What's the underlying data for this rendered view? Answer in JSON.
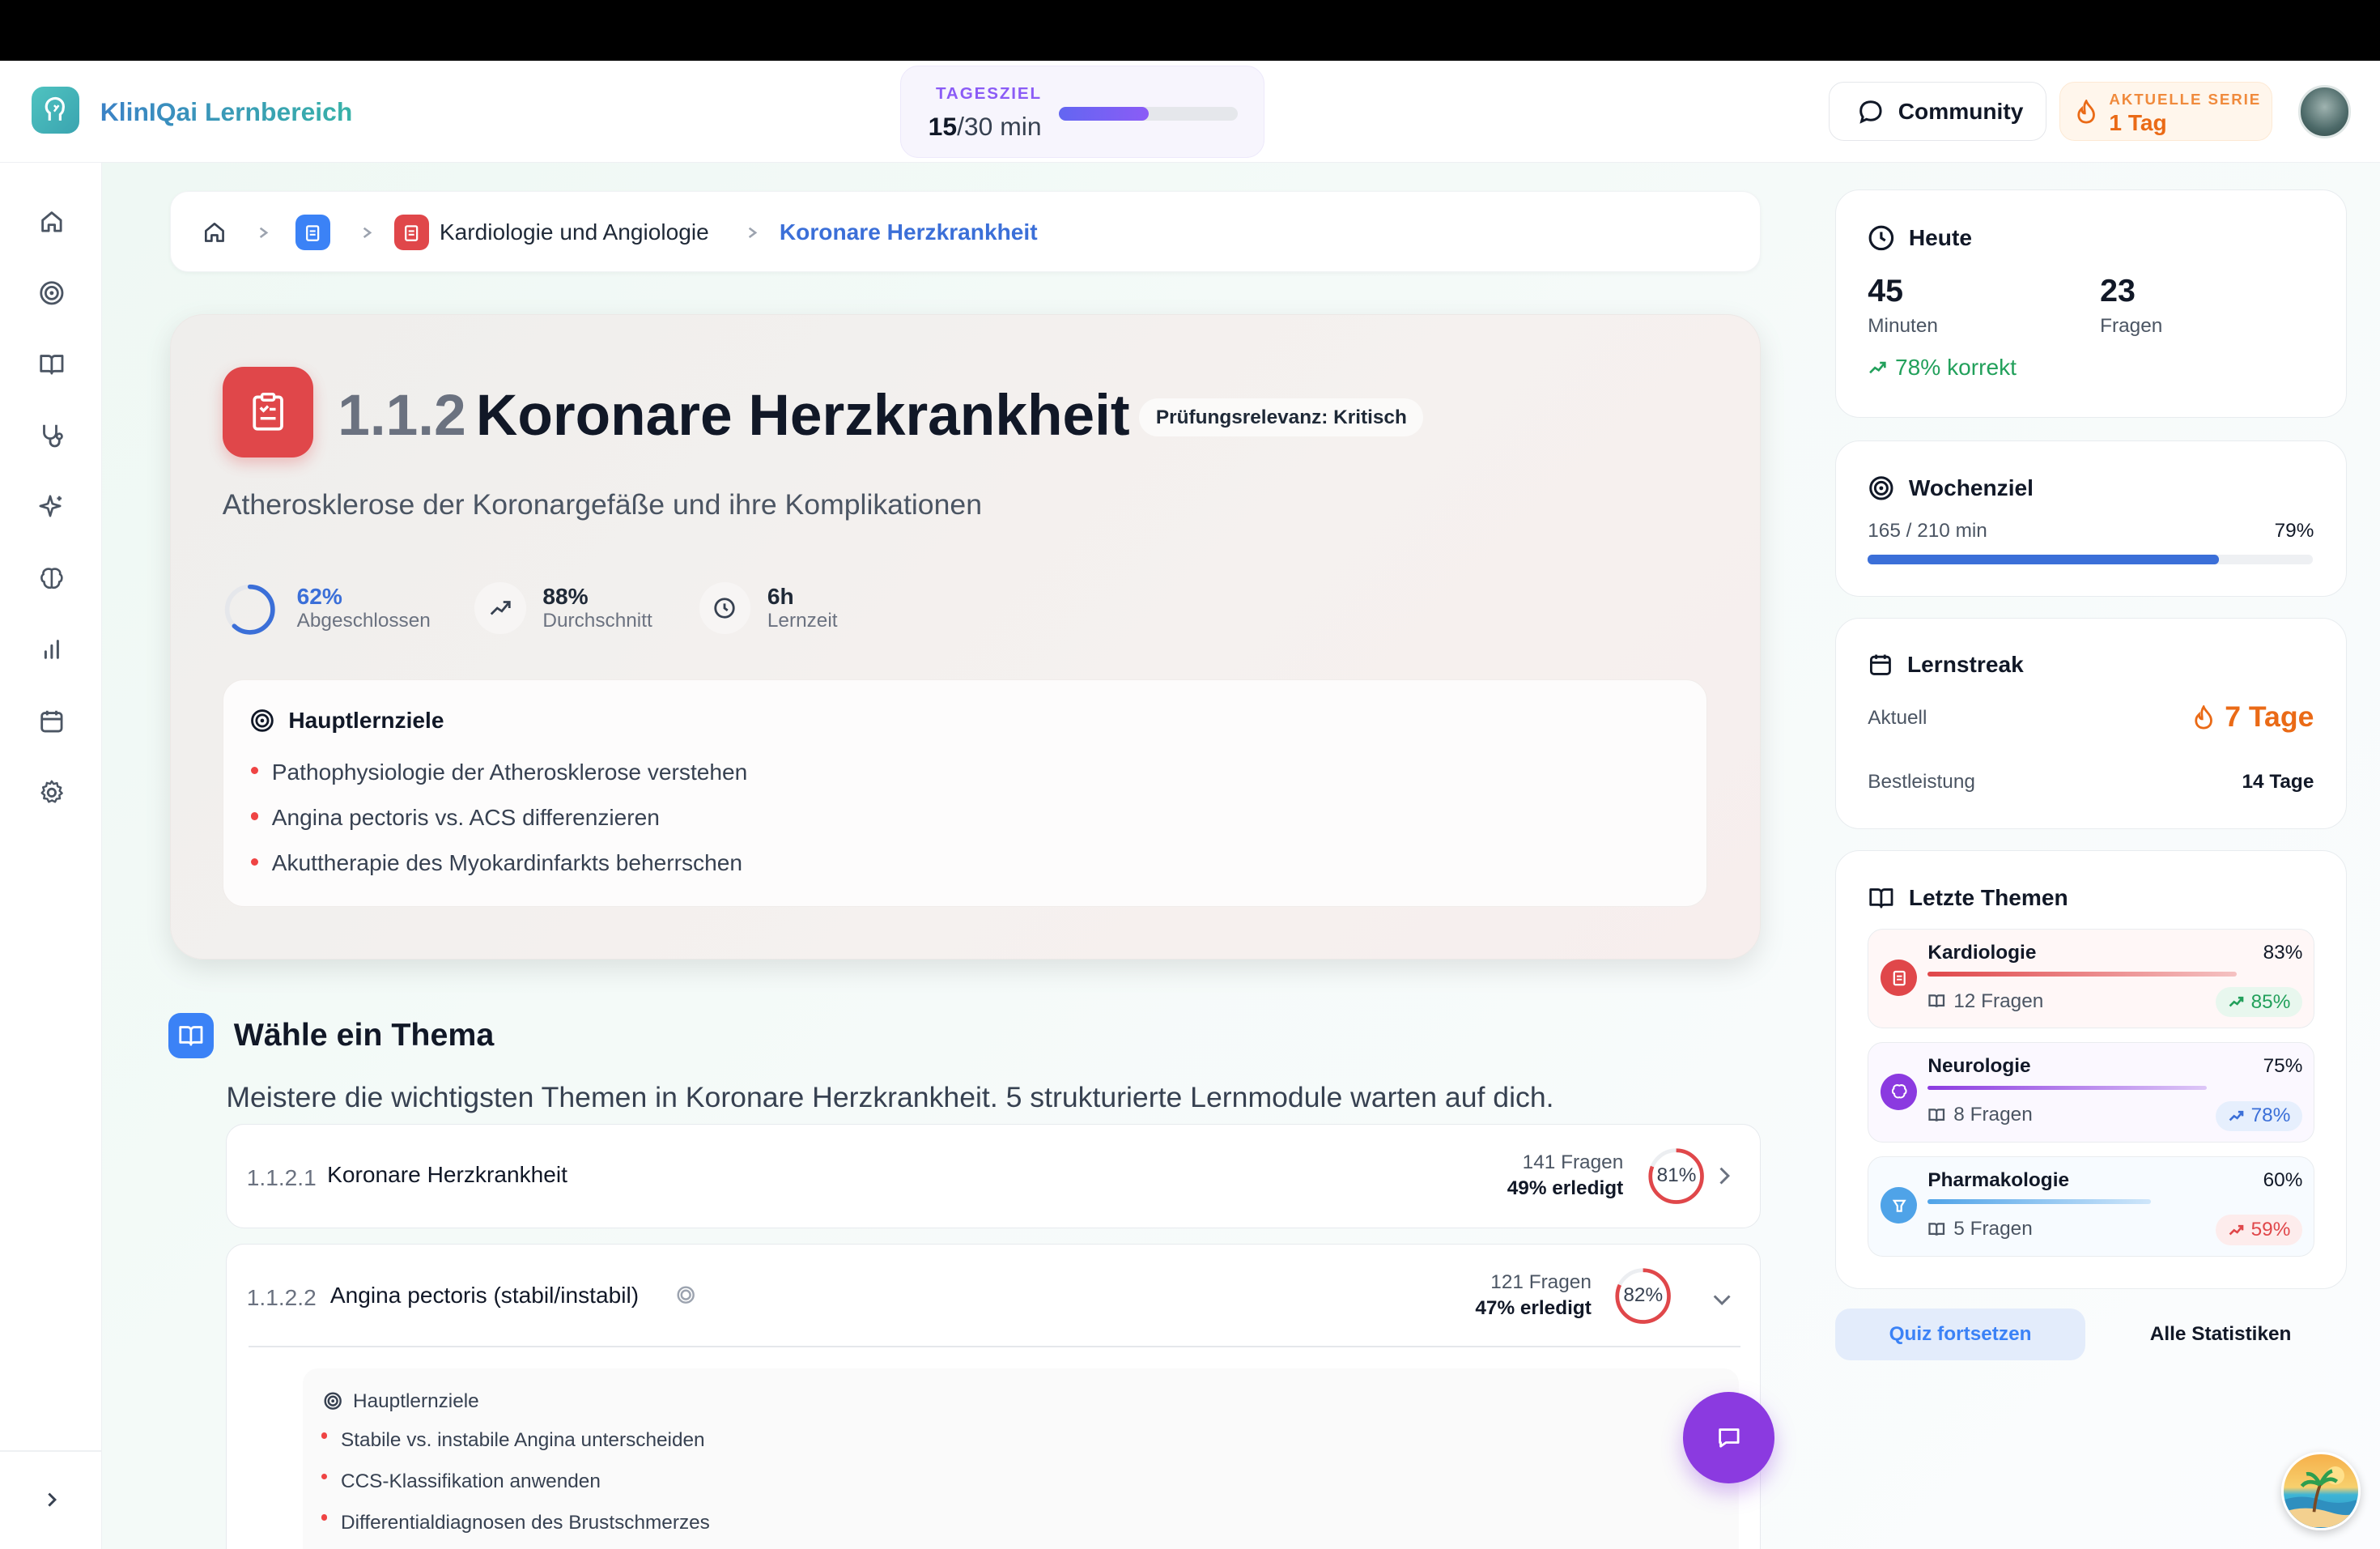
{
  "header": {
    "brand": "KlinIQai Lernbereich",
    "daily_goal": {
      "label": "TAGESZIEL",
      "current": "15",
      "target_text": "/30 min",
      "progress": 0.5
    },
    "community_label": "Community",
    "streak": {
      "label": "AKTUELLE SERIE",
      "value": "1 Tag"
    }
  },
  "sidebar": {
    "items": [
      {
        "icon": "home-icon"
      },
      {
        "icon": "target-icon"
      },
      {
        "icon": "book-icon"
      },
      {
        "icon": "stethoscope-icon"
      },
      {
        "icon": "sparkles-icon"
      },
      {
        "icon": "brain-icon"
      },
      {
        "icon": "bar-chart-icon"
      },
      {
        "icon": "calendar-icon"
      },
      {
        "icon": "settings-icon"
      }
    ],
    "collapse_icon": "chevron-right-icon"
  },
  "breadcrumb": {
    "items": [
      "Kardiologie und Angiologie",
      "Koronare Herzkrankheit"
    ]
  },
  "hero": {
    "number": "1.1.2",
    "title": "Koronare Herzkrankheit",
    "relevance": "Prüfungsrelevanz: Kritisch",
    "subtitle": "Atherosklerose der Koronargefäße und ihre Komplikationen",
    "stats": [
      {
        "value": "62%",
        "label": "Abgeschlossen",
        "progress": 0.62
      },
      {
        "value": "88%",
        "label": "Durchschnitt"
      },
      {
        "value": "6h",
        "label": "Lernzeit"
      }
    ],
    "objectives_title": "Hauptlernziele",
    "objectives": [
      "Pathophysiologie der Atherosklerose verstehen",
      "Angina pectoris vs. ACS differenzieren",
      "Akuttherapie des Myokardinfarkts beherrschen"
    ]
  },
  "choose": {
    "title": "Wähle ein Thema",
    "subtitle": "Meistere die wichtigsten Themen in Koronare Herzkrankheit. 5 strukturierte Lernmodule warten auf dich."
  },
  "modules": [
    {
      "num": "1.1.2.1",
      "name": "Koronare Herzkrankheit",
      "questions": "141 Fragen",
      "done": "49% erledigt",
      "score": "81%",
      "score_value": 0.81
    },
    {
      "num": "1.1.2.2",
      "name": "Angina pectoris (stabil/instabil)",
      "questions": "121 Fragen",
      "done": "47% erledigt",
      "score": "82%",
      "score_value": 0.82,
      "objectives_title": "Hauptlernziele",
      "objectives": [
        "Stabile vs. instabile Angina unterscheiden",
        "CCS-Klassifikation anwenden",
        "Differentialdiagnosen des Brustschmerzes"
      ]
    }
  ],
  "today": {
    "title": "Heute",
    "minutes": "45",
    "minutes_label": "Minuten",
    "questions": "23",
    "questions_label": "Fragen",
    "correct": "78% korrekt"
  },
  "week": {
    "title": "Wochenziel",
    "progress_text": "165 / 210 min",
    "percent": "79%",
    "progress": 0.79
  },
  "streak": {
    "title": "Lernstreak",
    "current_label": "Aktuell",
    "current_value": "7 Tage",
    "best_label": "Bestleistung",
    "best_value": "14 Tage"
  },
  "recent": {
    "title": "Letzte Themen",
    "topics": [
      {
        "name": "Kardiologie",
        "percent": "83%",
        "progress": 0.83,
        "questions": "12 Fragen",
        "trend": "85%",
        "color": "#e0474a"
      },
      {
        "name": "Neurologie",
        "percent": "75%",
        "progress": 0.75,
        "questions": "8 Fragen",
        "trend": "78%",
        "color": "#8b3ae0"
      },
      {
        "name": "Pharmakologie",
        "percent": "60%",
        "progress": 0.6,
        "questions": "5 Fragen",
        "trend": "59%",
        "color": "#4fa3e8"
      }
    ]
  },
  "actions": {
    "quiz": "Quiz fortsetzen",
    "stats": "Alle Statistiken"
  },
  "colors": {
    "accent": "#3b82f6",
    "danger": "#e0474a",
    "purple": "#8b3ae0",
    "streak": "#ea6a16",
    "success": "#22a05b"
  }
}
